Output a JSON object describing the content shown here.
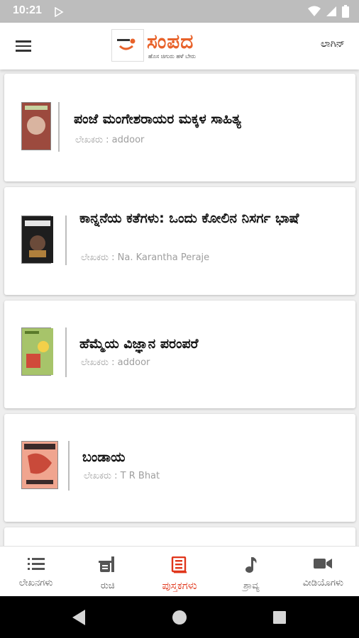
{
  "status_bar": {
    "time": "10:21"
  },
  "app_bar": {
    "logo_name": "ಸಂಪದ",
    "logo_tagline": "ಹೊಸ ಚಿಗುರು ಹಳೆ ಬೇರು",
    "login_label": "ಲಾಗಿನ್"
  },
  "books": [
    {
      "title": "ಪಂಜೆ ಮಂಗೇಶರಾಯರ ಮಕ್ಕಳ ಸಾಹಿತ್ಯ",
      "author": "ಲೇಖಕರು : addoor",
      "cover_color": "#8a3b3b"
    },
    {
      "title": "ಕಾನ್ನನೆಯ ಕತೆಗಳು: ಒಂದು ಕೋಲಿನ ನಿಸರ್ಗ ಭಾಷೆ",
      "author": "ಲೇಖಕರು : Na. Karantha Peraje",
      "cover_color": "#2b2b2b"
    },
    {
      "title": "ಹೆಮ್ಮೆಯ ವಿಜ್ಞಾನ ಪರಂಪರೆ",
      "author": "ಲೇಖಕರು : addoor",
      "cover_color": "#9ab85a"
    },
    {
      "title": "ಬಂಡಾಯ",
      "author": "ಲೇಖಕರು : T R Bhat",
      "cover_color": "#e38a78"
    }
  ],
  "bottom_nav": [
    {
      "label": "ಲೇಖನಗಳು",
      "icon": "list-icon"
    },
    {
      "label": "ರುಚಿ",
      "icon": "recipe-icon"
    },
    {
      "label": "ಪುಸ್ತಕಗಳು",
      "icon": "book-icon",
      "active": true
    },
    {
      "label": "ಶ್ರಾವ್ಯ",
      "icon": "music-note-icon"
    },
    {
      "label": "ವೀಡಿಯೊಗಳು",
      "icon": "video-camera-icon"
    }
  ],
  "colors": {
    "accent": "#e0351a",
    "logo": "#e8622a"
  }
}
